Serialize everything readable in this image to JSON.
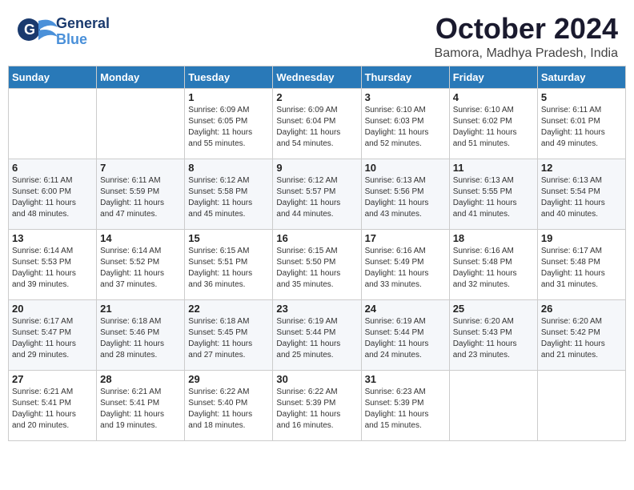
{
  "header": {
    "logo_line1": "General",
    "logo_line2": "Blue",
    "month": "October 2024",
    "location": "Bamora, Madhya Pradesh, India"
  },
  "weekdays": [
    "Sunday",
    "Monday",
    "Tuesday",
    "Wednesday",
    "Thursday",
    "Friday",
    "Saturday"
  ],
  "weeks": [
    [
      {
        "day": "",
        "info": ""
      },
      {
        "day": "",
        "info": ""
      },
      {
        "day": "1",
        "info": "Sunrise: 6:09 AM\nSunset: 6:05 PM\nDaylight: 11 hours\nand 55 minutes."
      },
      {
        "day": "2",
        "info": "Sunrise: 6:09 AM\nSunset: 6:04 PM\nDaylight: 11 hours\nand 54 minutes."
      },
      {
        "day": "3",
        "info": "Sunrise: 6:10 AM\nSunset: 6:03 PM\nDaylight: 11 hours\nand 52 minutes."
      },
      {
        "day": "4",
        "info": "Sunrise: 6:10 AM\nSunset: 6:02 PM\nDaylight: 11 hours\nand 51 minutes."
      },
      {
        "day": "5",
        "info": "Sunrise: 6:11 AM\nSunset: 6:01 PM\nDaylight: 11 hours\nand 49 minutes."
      }
    ],
    [
      {
        "day": "6",
        "info": "Sunrise: 6:11 AM\nSunset: 6:00 PM\nDaylight: 11 hours\nand 48 minutes."
      },
      {
        "day": "7",
        "info": "Sunrise: 6:11 AM\nSunset: 5:59 PM\nDaylight: 11 hours\nand 47 minutes."
      },
      {
        "day": "8",
        "info": "Sunrise: 6:12 AM\nSunset: 5:58 PM\nDaylight: 11 hours\nand 45 minutes."
      },
      {
        "day": "9",
        "info": "Sunrise: 6:12 AM\nSunset: 5:57 PM\nDaylight: 11 hours\nand 44 minutes."
      },
      {
        "day": "10",
        "info": "Sunrise: 6:13 AM\nSunset: 5:56 PM\nDaylight: 11 hours\nand 43 minutes."
      },
      {
        "day": "11",
        "info": "Sunrise: 6:13 AM\nSunset: 5:55 PM\nDaylight: 11 hours\nand 41 minutes."
      },
      {
        "day": "12",
        "info": "Sunrise: 6:13 AM\nSunset: 5:54 PM\nDaylight: 11 hours\nand 40 minutes."
      }
    ],
    [
      {
        "day": "13",
        "info": "Sunrise: 6:14 AM\nSunset: 5:53 PM\nDaylight: 11 hours\nand 39 minutes."
      },
      {
        "day": "14",
        "info": "Sunrise: 6:14 AM\nSunset: 5:52 PM\nDaylight: 11 hours\nand 37 minutes."
      },
      {
        "day": "15",
        "info": "Sunrise: 6:15 AM\nSunset: 5:51 PM\nDaylight: 11 hours\nand 36 minutes."
      },
      {
        "day": "16",
        "info": "Sunrise: 6:15 AM\nSunset: 5:50 PM\nDaylight: 11 hours\nand 35 minutes."
      },
      {
        "day": "17",
        "info": "Sunrise: 6:16 AM\nSunset: 5:49 PM\nDaylight: 11 hours\nand 33 minutes."
      },
      {
        "day": "18",
        "info": "Sunrise: 6:16 AM\nSunset: 5:48 PM\nDaylight: 11 hours\nand 32 minutes."
      },
      {
        "day": "19",
        "info": "Sunrise: 6:17 AM\nSunset: 5:48 PM\nDaylight: 11 hours\nand 31 minutes."
      }
    ],
    [
      {
        "day": "20",
        "info": "Sunrise: 6:17 AM\nSunset: 5:47 PM\nDaylight: 11 hours\nand 29 minutes."
      },
      {
        "day": "21",
        "info": "Sunrise: 6:18 AM\nSunset: 5:46 PM\nDaylight: 11 hours\nand 28 minutes."
      },
      {
        "day": "22",
        "info": "Sunrise: 6:18 AM\nSunset: 5:45 PM\nDaylight: 11 hours\nand 27 minutes."
      },
      {
        "day": "23",
        "info": "Sunrise: 6:19 AM\nSunset: 5:44 PM\nDaylight: 11 hours\nand 25 minutes."
      },
      {
        "day": "24",
        "info": "Sunrise: 6:19 AM\nSunset: 5:44 PM\nDaylight: 11 hours\nand 24 minutes."
      },
      {
        "day": "25",
        "info": "Sunrise: 6:20 AM\nSunset: 5:43 PM\nDaylight: 11 hours\nand 23 minutes."
      },
      {
        "day": "26",
        "info": "Sunrise: 6:20 AM\nSunset: 5:42 PM\nDaylight: 11 hours\nand 21 minutes."
      }
    ],
    [
      {
        "day": "27",
        "info": "Sunrise: 6:21 AM\nSunset: 5:41 PM\nDaylight: 11 hours\nand 20 minutes."
      },
      {
        "day": "28",
        "info": "Sunrise: 6:21 AM\nSunset: 5:41 PM\nDaylight: 11 hours\nand 19 minutes."
      },
      {
        "day": "29",
        "info": "Sunrise: 6:22 AM\nSunset: 5:40 PM\nDaylight: 11 hours\nand 18 minutes."
      },
      {
        "day": "30",
        "info": "Sunrise: 6:22 AM\nSunset: 5:39 PM\nDaylight: 11 hours\nand 16 minutes."
      },
      {
        "day": "31",
        "info": "Sunrise: 6:23 AM\nSunset: 5:39 PM\nDaylight: 11 hours\nand 15 minutes."
      },
      {
        "day": "",
        "info": ""
      },
      {
        "day": "",
        "info": ""
      }
    ]
  ]
}
